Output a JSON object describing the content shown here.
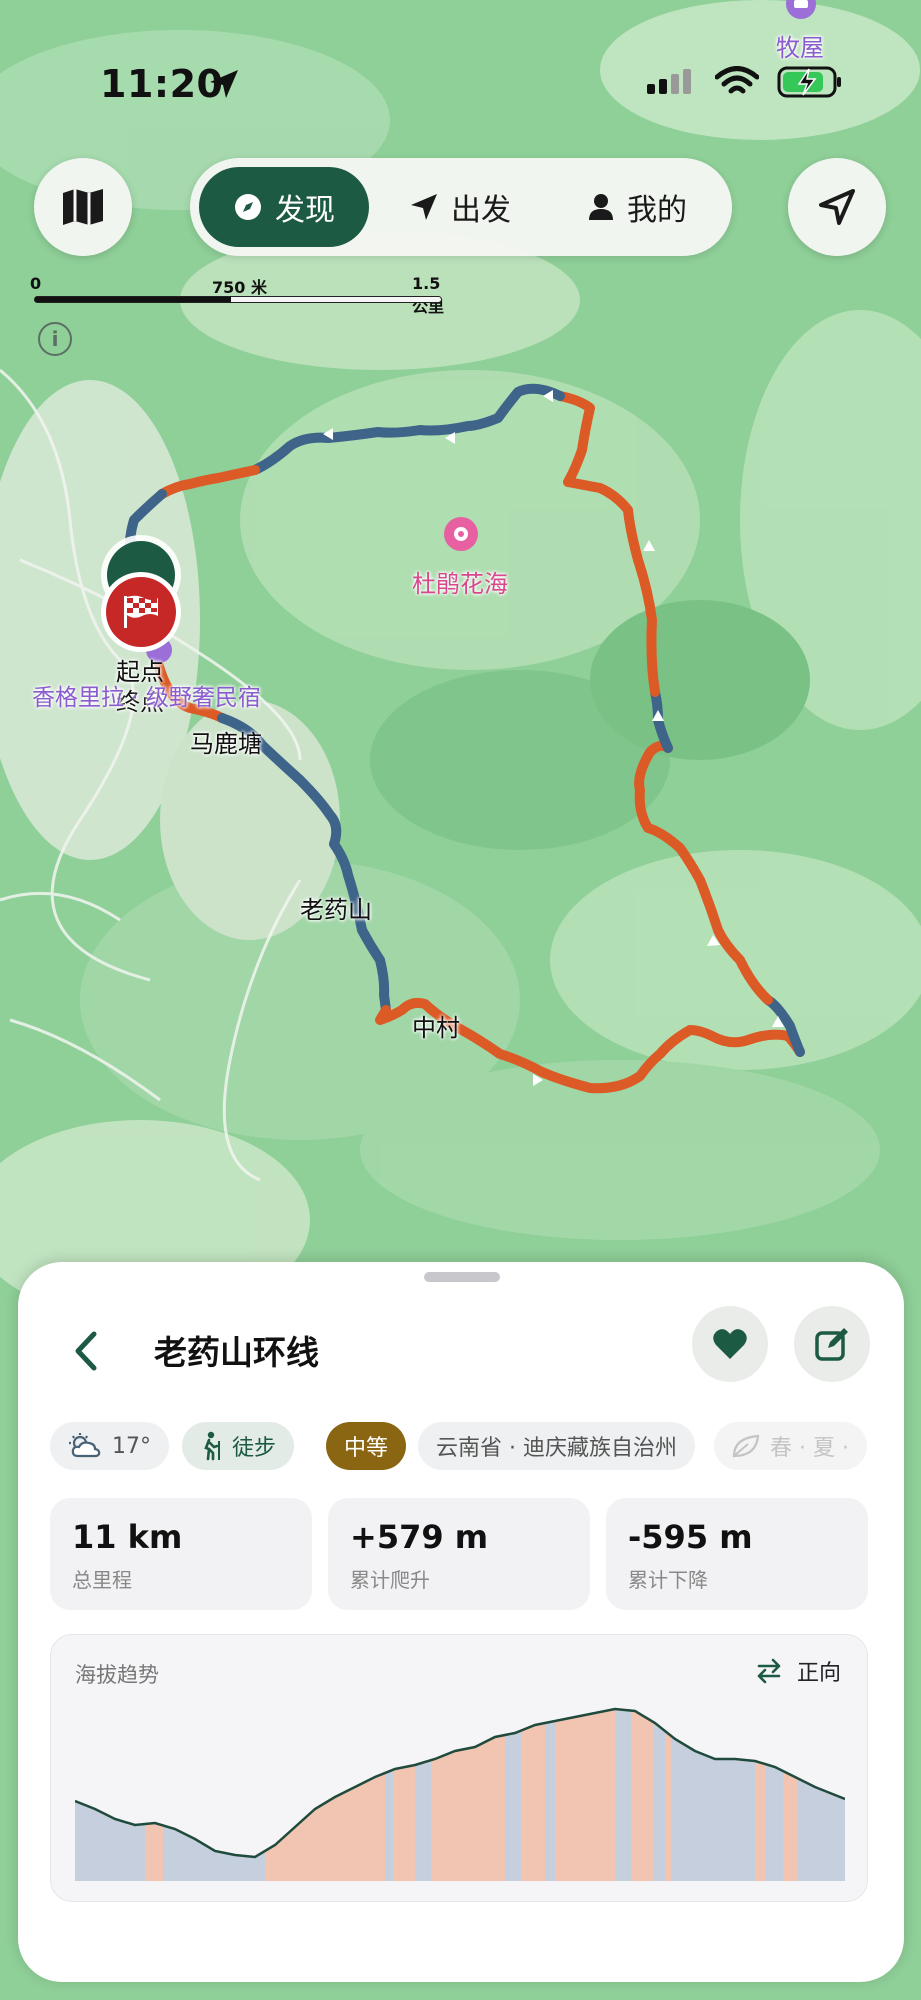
{
  "status_bar": {
    "time": "11:20"
  },
  "nav": {
    "tabs": [
      {
        "label": "发现",
        "icon": "compass-icon",
        "active": true
      },
      {
        "label": "出发",
        "icon": "location-arrow-icon",
        "active": false
      },
      {
        "label": "我的",
        "icon": "person-icon",
        "active": false
      }
    ]
  },
  "scale": {
    "zero": "0",
    "mid": "750 米",
    "max": "1.5 公里"
  },
  "map": {
    "labels": {
      "top_poi": "牧屋",
      "flower_sea": "杜鹃花海",
      "start": "起点",
      "end": "终点",
      "lodge": "香格里拉 · 级野奢民宿",
      "matang": "马鹿塘",
      "laoyaoshan": "老药山",
      "zhongcun": "中村"
    },
    "route_colors": {
      "flat": "#3e6489",
      "climb": "#dc5a26"
    }
  },
  "route": {
    "title": "老药山环线",
    "chips": {
      "weather": "17°",
      "activity": "徒步",
      "difficulty": "中等",
      "region": "云南省 · 迪庆藏族自治州",
      "season": "春 · 夏 ·"
    },
    "stats": [
      {
        "value": "11 km",
        "label": "总里程"
      },
      {
        "value": "+579 m",
        "label": "累计爬升"
      },
      {
        "value": "-595 m",
        "label": "累计下降"
      }
    ],
    "elevation": {
      "title": "海拔趋势",
      "direction": "正向"
    }
  }
}
